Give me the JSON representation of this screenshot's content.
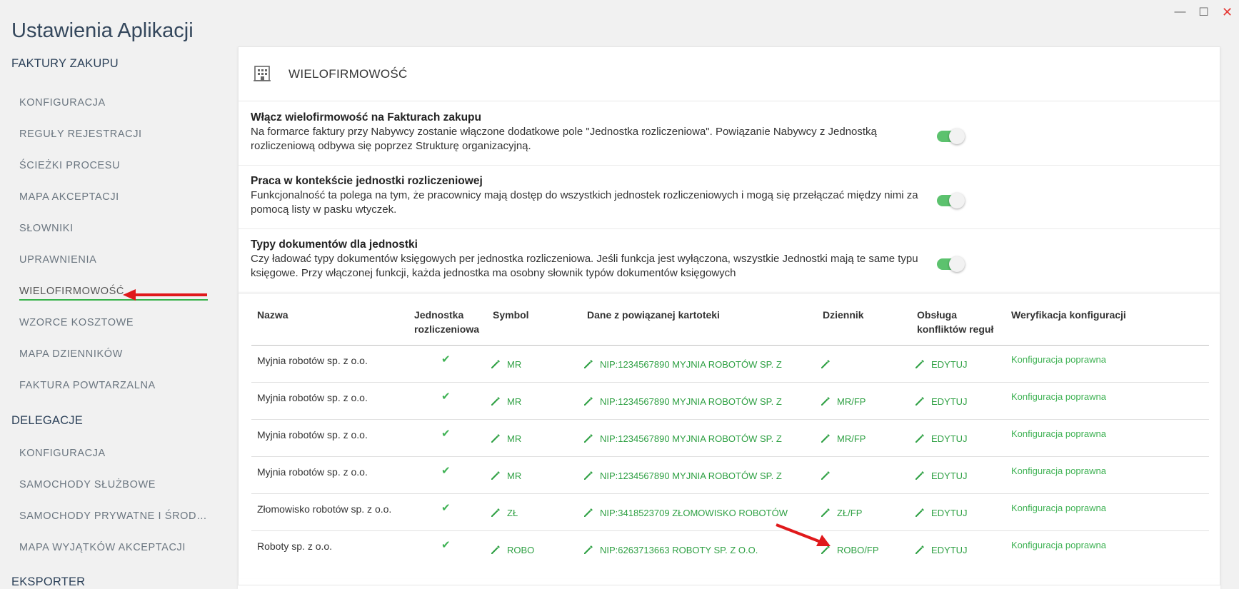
{
  "window": {
    "minimize": "—",
    "maximize": "☐",
    "close": "✕"
  },
  "app_title": "Ustawienia Aplikacji",
  "sidebar": {
    "sections": [
      {
        "label": "FAKTURY ZAKUPU"
      },
      {
        "label": "DELEGACJE"
      },
      {
        "label": "EKSPORTER"
      }
    ],
    "items": [
      {
        "label": "KONFIGURACJA"
      },
      {
        "label": "REGUŁY REJESTRACJI"
      },
      {
        "label": "ŚCIEŻKI PROCESU"
      },
      {
        "label": "MAPA AKCEPTACJI"
      },
      {
        "label": "SŁOWNIKI"
      },
      {
        "label": "UPRAWNIENIA"
      },
      {
        "label": "WIELOFIRMOWOŚĆ",
        "active": true
      },
      {
        "label": "WZORCE KOSZTOWE"
      },
      {
        "label": "MAPA DZIENNIKÓW"
      },
      {
        "label": "FAKTURA POWTARZALNA"
      },
      {
        "label": "KONFIGURACJA"
      },
      {
        "label": "SAMOCHODY SŁUŻBOWE"
      },
      {
        "label": "SAMOCHODY PRYWATNE I ŚROD…"
      },
      {
        "label": "MAPA WYJĄTKÓW AKCEPTACJI"
      }
    ]
  },
  "card": {
    "title": "WIELOFIRMOWOŚĆ",
    "settings": [
      {
        "title": "Włącz wielofirmowość na Fakturach zakupu",
        "desc": "Na formarce faktury przy Nabywcy zostanie włączone dodatkowe pole \"Jednostka rozliczeniowa\". Powiązanie Nabywcy z Jednostką rozliczeniową odbywa się poprzez Strukturę organizacyjną.",
        "enabled": true
      },
      {
        "title": "Praca w kontekście jednostki rozliczeniowej",
        "desc": "Funkcjonalność ta polega na tym, że pracownicy mają dostęp do wszystkich jednostek rozliczeniowych i mogą się przełączać między nimi za pomocą listy w pasku wtyczek.",
        "enabled": true
      },
      {
        "title": "Typy dokumentów dla jednostki",
        "desc": "Czy ładować typy dokumentów księgowych per jednostka rozliczeniowa. Jeśli funkcja jest wyłączona, wszystkie Jednostki mają te same typu księgowe. Przy włączonej funkcji, każda jednostka ma osobny słownik typów dokumentów księgowych",
        "enabled": true
      }
    ]
  },
  "table": {
    "headers": {
      "name": "Nazwa",
      "unit_1": "Jednostka",
      "unit_2": "rozliczeniowa",
      "symbol": "Symbol",
      "linked": "Dane z powiązanej kartoteki",
      "journal": "Dziennik",
      "conflict_1": "Obsługa",
      "conflict_2": "konfliktów reguł",
      "verify": "Weryfikacja konfiguracji"
    },
    "rows": [
      {
        "name": "Myjnia robotów sp. z o.o.",
        "unit": "✔",
        "symbol": "MR",
        "linked": "NIP:1234567890 MYJNIA ROBOTÓW SP. Z",
        "journal": "",
        "conflict": "EDYTUJ",
        "verify": "Konfiguracja poprawna"
      },
      {
        "name": "Myjnia robotów sp. z o.o.",
        "unit": "✔",
        "symbol": "MR",
        "linked": "NIP:1234567890 MYJNIA ROBOTÓW SP. Z",
        "journal": "MR/FP",
        "conflict": "EDYTUJ",
        "verify": "Konfiguracja poprawna"
      },
      {
        "name": "Myjnia robotów sp. z o.o.",
        "unit": "✔",
        "symbol": "MR",
        "linked": "NIP:1234567890 MYJNIA ROBOTÓW SP. Z",
        "journal": "MR/FP",
        "conflict": "EDYTUJ",
        "verify": "Konfiguracja poprawna"
      },
      {
        "name": "Myjnia robotów sp. z o.o.",
        "unit": "✔",
        "symbol": "MR",
        "linked": "NIP:1234567890 MYJNIA ROBOTÓW SP. Z",
        "journal": "",
        "conflict": "EDYTUJ",
        "verify": "Konfiguracja poprawna"
      },
      {
        "name": "Złomowisko robotów sp. z o.o.",
        "unit": "✔",
        "symbol": "ZŁ",
        "linked": "NIP:3418523709 ZŁOMOWISKO ROBOTÓW",
        "journal": "ZŁ/FP",
        "conflict": "EDYTUJ",
        "verify": "Konfiguracja poprawna"
      },
      {
        "name": "Roboty sp. z o.o.",
        "unit": "✔",
        "symbol": "ROBO",
        "linked": "NIP:6263713663 ROBOTY SP. Z O.O.",
        "journal": "ROBO/FP",
        "conflict": "EDYTUJ",
        "verify": "Konfiguracja poprawna"
      }
    ]
  },
  "colors": {
    "accent_green": "#2ea043",
    "toggle_on": "#5cc26e",
    "annotation_red": "#e0191b"
  }
}
